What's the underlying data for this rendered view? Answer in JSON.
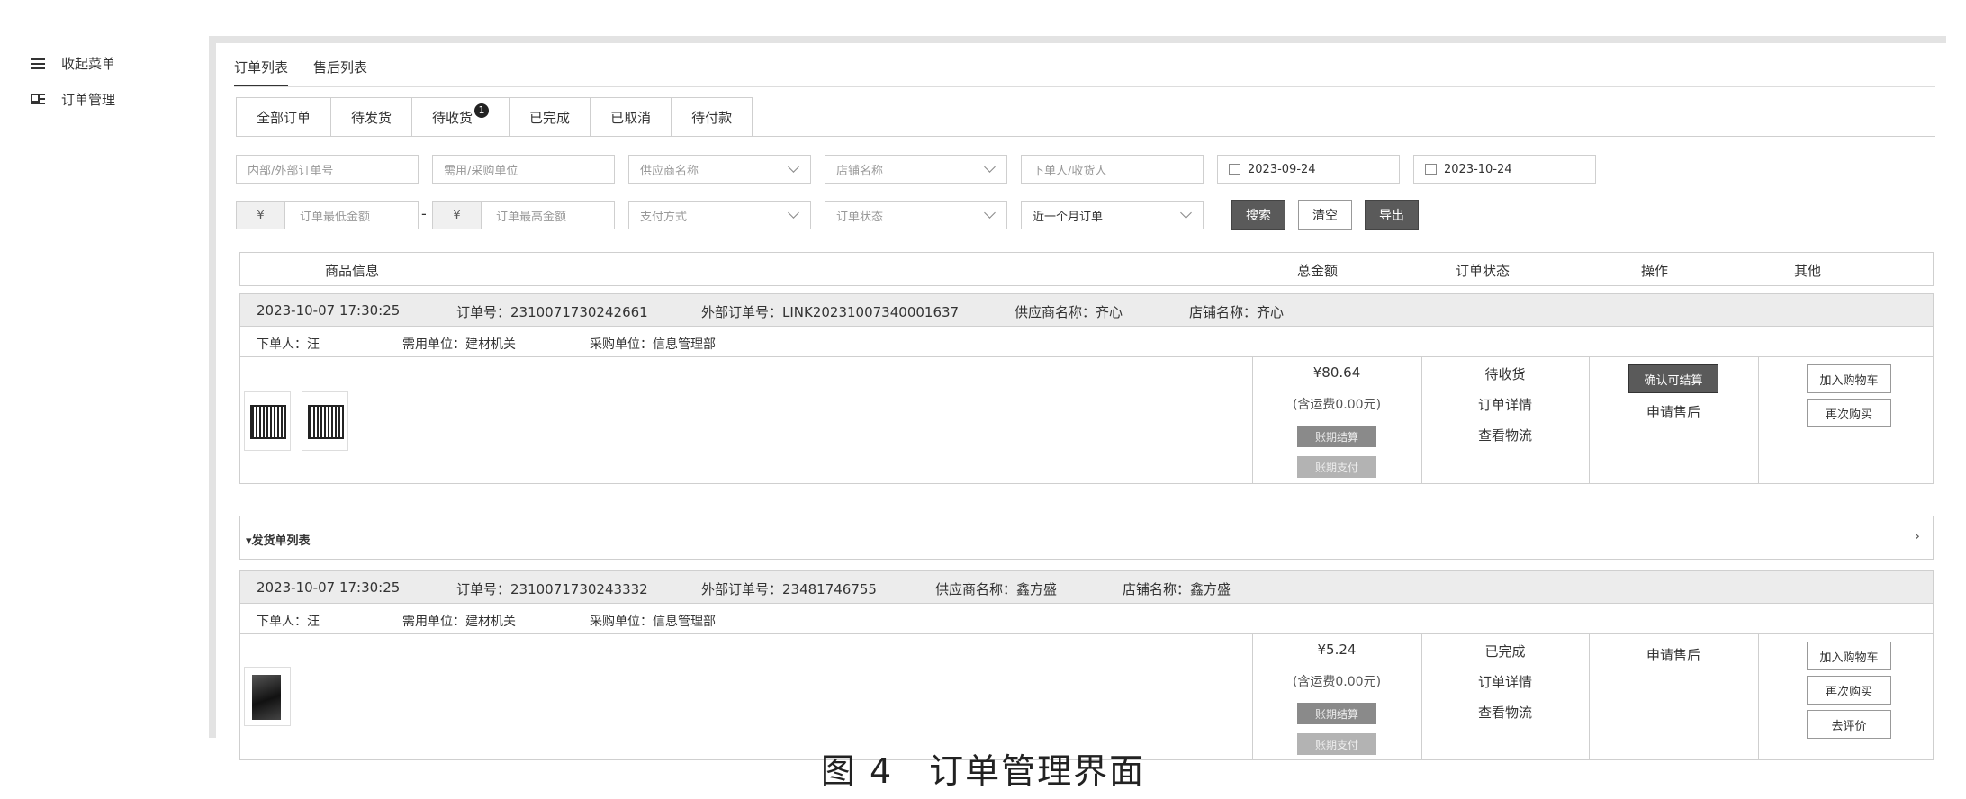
{
  "sidebar": {
    "items": [
      {
        "label": "收起菜单",
        "icon": "collapse-menu-icon"
      },
      {
        "label": "订单管理",
        "icon": "order-grid-icon"
      }
    ]
  },
  "top_tabs": [
    {
      "label": "订单列表",
      "active": true
    },
    {
      "label": "售后列表",
      "active": false
    }
  ],
  "status_tabs": [
    {
      "label": "全部订单",
      "active": true
    },
    {
      "label": "待发货"
    },
    {
      "label": "待收货",
      "badge": "1"
    },
    {
      "label": "已完成"
    },
    {
      "label": "已取消"
    },
    {
      "label": "待付款"
    }
  ],
  "filters": {
    "order_no": "内部/外部订单号",
    "unit": "需用/采购单位",
    "supplier": "供应商名称",
    "store": "店铺名称",
    "person": "下单人/收货人",
    "date_start": "2023-09-24",
    "date_end": "2023-10-24",
    "currency": "¥",
    "min_amount": "订单最低金额",
    "max_amount": "订单最高金额",
    "dash": "-",
    "pay_method": "支付方式",
    "order_status": "订单状态",
    "period": "近一个月订单",
    "search_btn": "搜索",
    "clear_btn": "清空",
    "export_btn": "导出"
  },
  "table_header": {
    "goods": "商品信息",
    "total": "总金额",
    "status": "订单状态",
    "action": "操作",
    "other": "其他"
  },
  "orders": [
    {
      "time": "2023-10-07 17:30:25",
      "order_no": "订单号：2310071730242661",
      "external_no": "外部订单号：LINK20231007340001637",
      "supplier": "供应商名称：齐心",
      "store": "店铺名称：齐心",
      "buyer": "下单人：汪",
      "demand_unit": "需用单位：建材机关",
      "purchase_unit": "采购单位：信息管理部",
      "price": "¥80.64",
      "shipping_note": "(含运费0.00元)",
      "chip1": "账期结算",
      "chip2": "账期支付",
      "status": "待收货",
      "detail": "订单详情",
      "logistics": "查看物流",
      "confirm_btn": "确认可结算",
      "after_sale": "申请售后",
      "add_cart": "加入购物车",
      "buy_again": "再次购买"
    },
    {
      "time": "2023-10-07 17:30:25",
      "order_no": "订单号：2310071730243332",
      "external_no": "外部订单号：23481746755",
      "supplier": "供应商名称：鑫方盛",
      "store": "店铺名称：鑫方盛",
      "buyer": "下单人：汪",
      "demand_unit": "需用单位：建材机关",
      "purchase_unit": "采购单位：信息管理部",
      "price": "¥5.24",
      "shipping_note": "(含运费0.00元)",
      "chip1": "账期结算",
      "chip2": "账期支付",
      "status": "已完成",
      "detail": "订单详情",
      "logistics": "查看物流",
      "after_sale": "申请售后",
      "add_cart": "加入购物车",
      "buy_again": "再次购买",
      "review": "去评价"
    }
  ],
  "shipment_list": "▾发货单列表",
  "shipment_arrow": "›",
  "caption": "图 4　订单管理界面"
}
